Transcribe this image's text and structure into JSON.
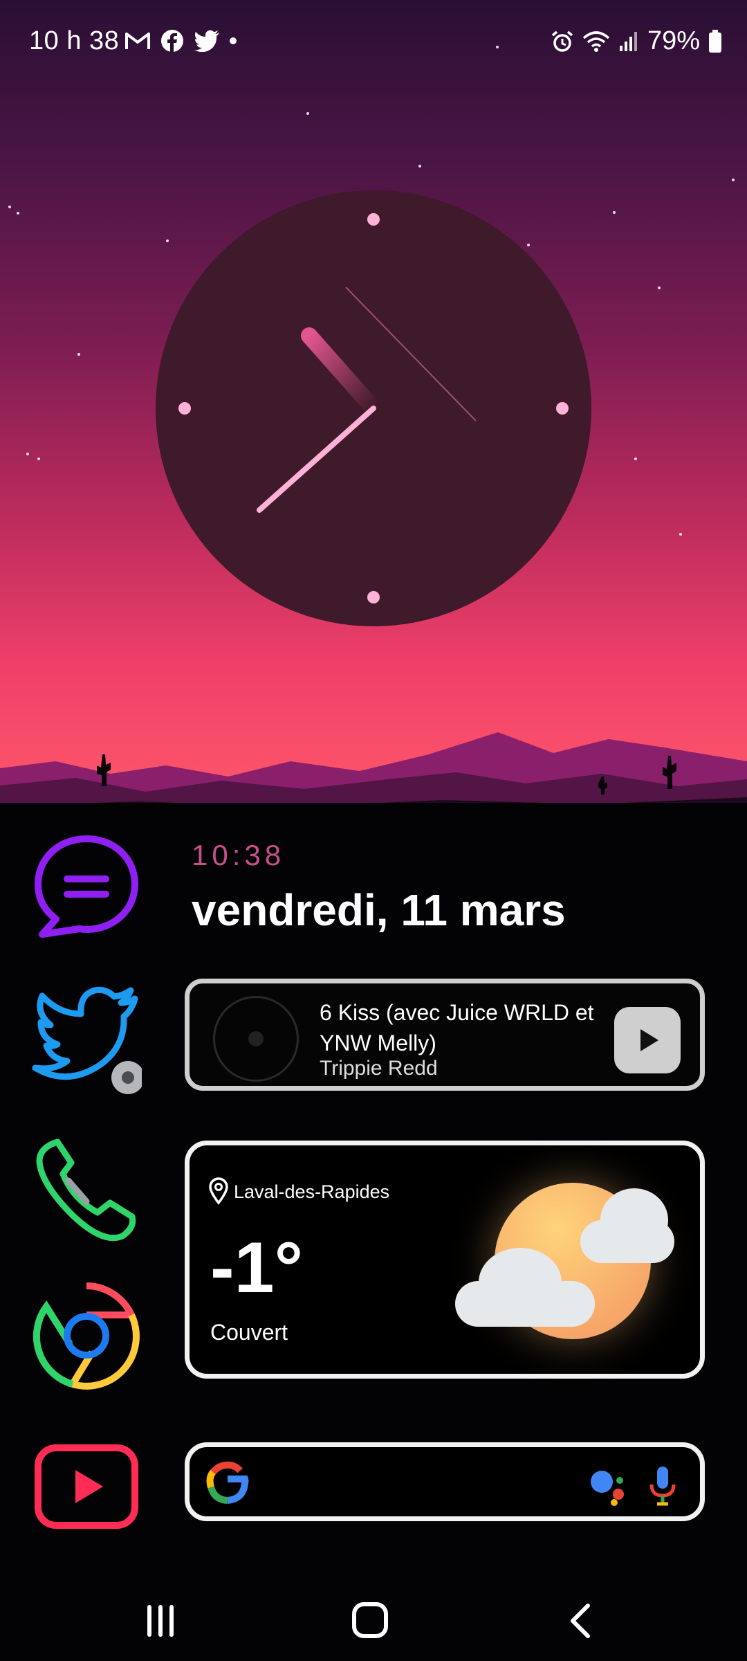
{
  "status_bar": {
    "time": "10 h 38",
    "battery": "79%",
    "left_icons": [
      "gmail-icon",
      "facebook-icon",
      "twitter-icon",
      "more-dot"
    ],
    "right_icons": [
      "alarm-icon",
      "wifi-icon",
      "signal-icon",
      "battery-icon"
    ]
  },
  "clock_widget": {
    "hour": 10,
    "minute": 38,
    "accent": "#ffb1d8"
  },
  "date_widget": {
    "time": "10:38",
    "date": "vendredi, 11 mars"
  },
  "music_widget": {
    "title": "6 Kiss (avec Juice WRLD et YNW Melly)",
    "artist": "Trippie Redd"
  },
  "weather_widget": {
    "location": "Laval-des-Rapides",
    "temperature": "-1°",
    "condition": "Couvert"
  },
  "apps": [
    "Messages",
    "Twitter",
    "Téléphone",
    "Chrome",
    "YouTube"
  ],
  "search_bar": {
    "brand": "G"
  },
  "nav_bar": {
    "buttons": [
      "recent-apps",
      "home",
      "back"
    ]
  },
  "colors": {
    "messages": "#8f1ff2",
    "twitter": "#1d9bf0",
    "phone": "#2fd46b",
    "youtube": "#ff2d55",
    "date_time_text": "#c8508a"
  }
}
